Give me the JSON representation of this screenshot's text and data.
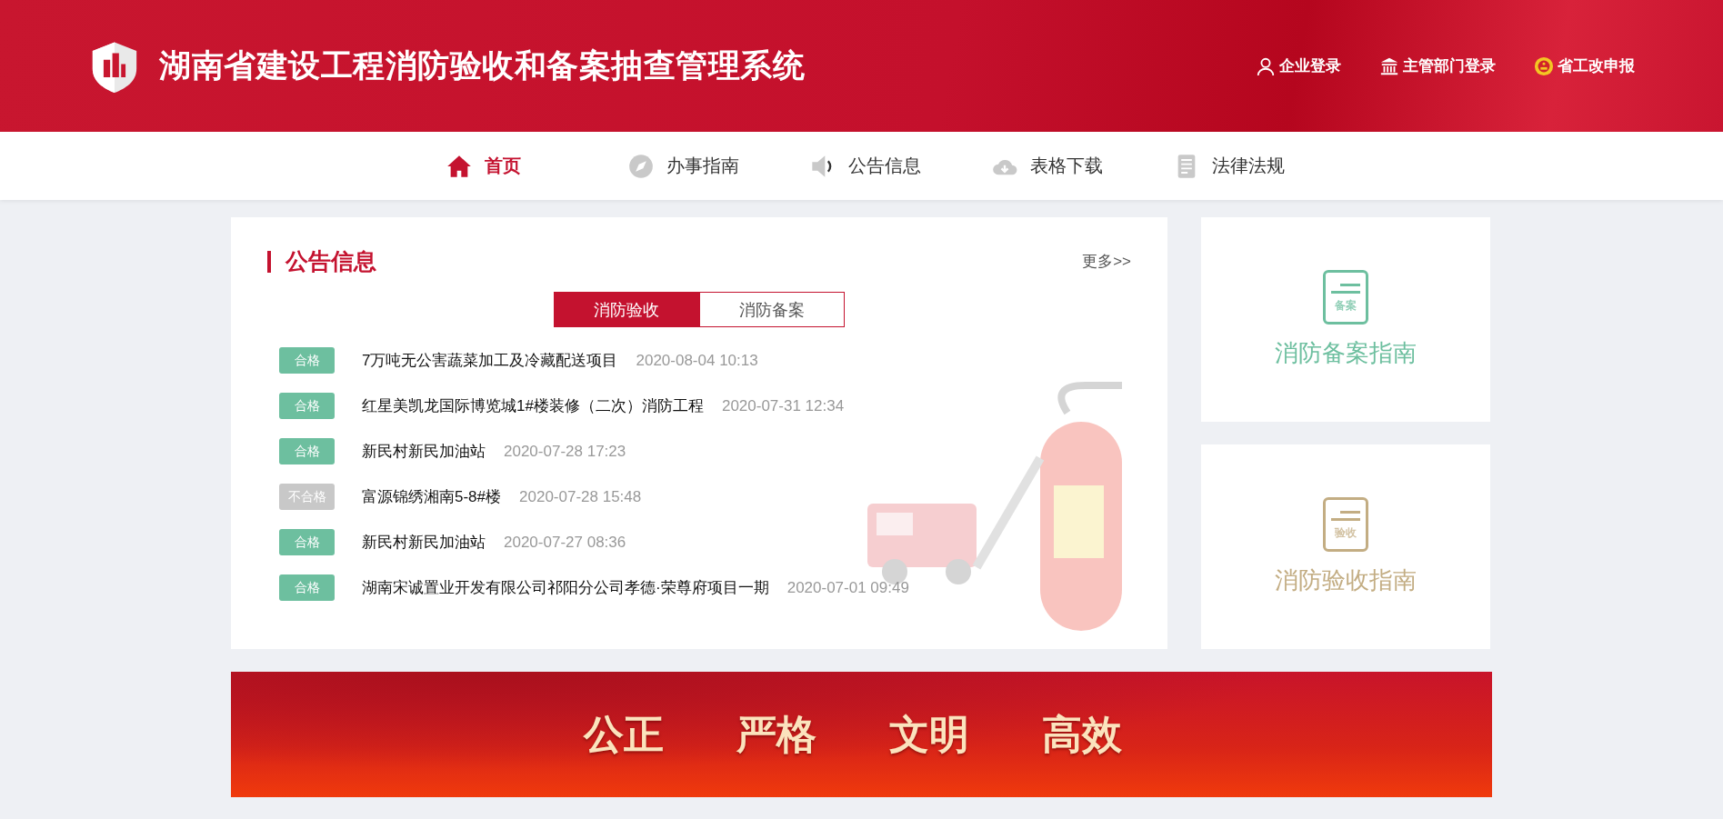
{
  "header": {
    "title": "湖南省建设工程消防验收和备案抽查管理系统",
    "links": [
      {
        "kind": "user",
        "label": "企业登录"
      },
      {
        "kind": "bank",
        "label": "主管部门登录"
      },
      {
        "kind": "emblem",
        "label": "省工改申报"
      }
    ]
  },
  "nav": [
    {
      "kind": "home",
      "label": "首页",
      "selected": true
    },
    {
      "kind": "compass",
      "label": "办事指南",
      "selected": false
    },
    {
      "kind": "speaker",
      "label": "公告信息",
      "selected": false
    },
    {
      "kind": "cloud",
      "label": "表格下载",
      "selected": false
    },
    {
      "kind": "book",
      "label": "法律法规",
      "selected": false
    }
  ],
  "notices": {
    "title": "公告信息",
    "more": "更多>>",
    "tabs": [
      {
        "label": "消防验收",
        "selected": true
      },
      {
        "label": "消防备案",
        "selected": false
      }
    ],
    "items": [
      {
        "badge": "合格",
        "passed": true,
        "text": "7万吨无公害蔬菜加工及冷藏配送项目",
        "time": "2020-08-04 10:13"
      },
      {
        "badge": "合格",
        "passed": true,
        "text": "红星美凯龙国际博览城1#楼装修（二次）消防工程",
        "time": "2020-07-31 12:34"
      },
      {
        "badge": "合格",
        "passed": true,
        "text": "新民村新民加油站",
        "time": "2020-07-28 17:23"
      },
      {
        "badge": "不合格",
        "passed": false,
        "text": "富源锦绣湘南5-8#楼",
        "time": "2020-07-28 15:48"
      },
      {
        "badge": "合格",
        "passed": true,
        "text": "新民村新民加油站",
        "time": "2020-07-27 08:36"
      },
      {
        "badge": "合格",
        "passed": true,
        "text": "湖南宋诚置业开发有限公司祁阳分公司孝德·荣尊府项目一期",
        "time": "2020-07-01 09:49"
      }
    ]
  },
  "guides": [
    {
      "icon_label": "备案",
      "label": "消防备案指南",
      "color": "#6dbf9f"
    },
    {
      "icon_label": "验收",
      "label": "消防验收指南",
      "color": "#c3ad83"
    }
  ],
  "banner": {
    "words": [
      "公正",
      "严格",
      "文明",
      "高效"
    ]
  }
}
